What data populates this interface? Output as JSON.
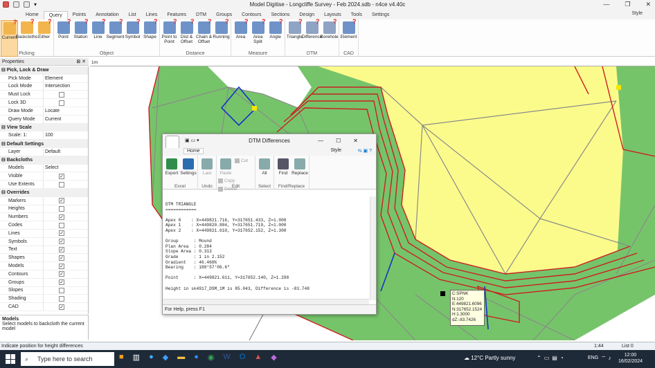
{
  "window": {
    "title": "Model Digitise - Longcliffe Survey - Feb 2024.sdb - n4ce v4.40c",
    "style_label": "Style"
  },
  "tabs": [
    "Home",
    "Query",
    "Points",
    "Annotation",
    "List",
    "Lines",
    "Features",
    "DTM",
    "Groups",
    "Contours",
    "Sections",
    "Design",
    "Layouts",
    "Tools",
    "Settings"
  ],
  "active_tab": "Query",
  "ribbon": {
    "groups": [
      {
        "label": "Picking",
        "buttons": [
          "Current",
          "Backcloths",
          "Either"
        ]
      },
      {
        "label": "Object",
        "buttons": [
          "Point",
          "Station",
          "Line",
          "Segment",
          "Symbol",
          "Shape"
        ]
      },
      {
        "label": "Distance",
        "buttons": [
          "Point to Point",
          "Dist & Offset",
          "Chain & Offset",
          "Running"
        ]
      },
      {
        "label": "Measure",
        "buttons": [
          "Area",
          "Area Split",
          "Angle"
        ]
      },
      {
        "label": "DTM",
        "buttons": [
          "Triangle",
          "Difference",
          "Borehole"
        ]
      },
      {
        "label": "CAD",
        "buttons": [
          "Element"
        ]
      }
    ]
  },
  "properties": {
    "header": "Properties",
    "rows": [
      {
        "type": "cat",
        "label": "Pick, Lock & Draw"
      },
      {
        "label": "Pick Mode",
        "value": "Element"
      },
      {
        "label": "Lock Mode",
        "value": "Intersection"
      },
      {
        "label": "Must Lock",
        "check": ""
      },
      {
        "label": "Lock 3D",
        "check": ""
      },
      {
        "label": "Draw Mode",
        "value": "Locate"
      },
      {
        "label": "Query Mode",
        "value": "Current"
      },
      {
        "type": "cat",
        "label": "View Scale"
      },
      {
        "label": "Scale: 1:",
        "value": "100"
      },
      {
        "type": "cat",
        "label": "Default Settings"
      },
      {
        "label": "Layer",
        "value": "Default"
      },
      {
        "type": "cat",
        "label": "Backcloths"
      },
      {
        "label": "Models",
        "value": "Select"
      },
      {
        "label": "Visible",
        "check": "✓"
      },
      {
        "label": "Use Extents",
        "check": ""
      },
      {
        "type": "cat",
        "label": "Overrides"
      },
      {
        "label": "Markers",
        "check": "✓"
      },
      {
        "label": "Heights",
        "check": ""
      },
      {
        "label": "Numbers",
        "check": "✓"
      },
      {
        "label": "Codes",
        "check": ""
      },
      {
        "label": "Lines",
        "check": "✓"
      },
      {
        "label": "Symbols",
        "check": "✓"
      },
      {
        "label": "Text",
        "check": "✓"
      },
      {
        "label": "Shapes",
        "check": "✓"
      },
      {
        "label": "Models",
        "check": "✓"
      },
      {
        "label": "Contours",
        "check": "✓"
      },
      {
        "label": "Groups",
        "check": "✓"
      },
      {
        "label": "Slopes",
        "check": ""
      },
      {
        "label": "Shading",
        "check": ""
      },
      {
        "label": "CAD",
        "check": "✓"
      }
    ],
    "help_title": "Models",
    "help_text": "Select models to backcloth the current model"
  },
  "ruler": {
    "label": "1m"
  },
  "status": {
    "left": "Indicate position for height differences",
    "mid": "1:44",
    "right": "List 0"
  },
  "dialog": {
    "title": "DTM Differences",
    "tab": "Home",
    "style_label": "Style",
    "groups": [
      {
        "label": "Excel",
        "buttons": [
          "Export",
          "Settings"
        ]
      },
      {
        "label": "Undo",
        "buttons": [
          "Last"
        ]
      },
      {
        "label": "Edit",
        "buttons": [
          "Paste",
          "Cut",
          "Copy",
          "Delete"
        ]
      },
      {
        "label": "Select",
        "buttons": [
          "All"
        ]
      },
      {
        "label": "Find/Replace",
        "buttons": [
          "Find",
          "Replace"
        ]
      }
    ],
    "text": "DTM TRIANGLE\n============\n\nApex 0    : X=449821.716, Y=317651.433, Z=1.000\nApex 1    : X=449820.884, Y=317651.719, Z=1.000\nApex 2    : X=449821.610, Y=317652.152, Z=1.300\n\nGroup      : Mound\nPlan Area  : 0.284\nSlope Area : 0.313\nGrade      : 1 in 2.152\nGradient   : 46.466%\nBearing    : 188°57'06.6\"\n\nPoint      : X=449821.611, Y=317652.140, Z=1.298\n\nHeight in sk4917_DSM_1M is 85.043, Difference is -83.748",
    "status": "For Help, press F1"
  },
  "tooltip": [
    "C:SPNK",
    "N:120",
    "E:449821.6096",
    "N:317652.1524",
    "H:1.3000",
    "dZ:-83.7426"
  ],
  "taskbar": {
    "search_placeholder": "Type here to search",
    "weather": "12°C  Partly sunny",
    "lang": "ENG",
    "time": "12:00",
    "date": "16/02/2024"
  },
  "colors": {
    "green": "#76c46a",
    "yellow": "#fbfb8c",
    "red": "#cc1f1f",
    "blue": "#1233c8",
    "grey": "#8a8a8a",
    "accent": "#0078d4"
  }
}
